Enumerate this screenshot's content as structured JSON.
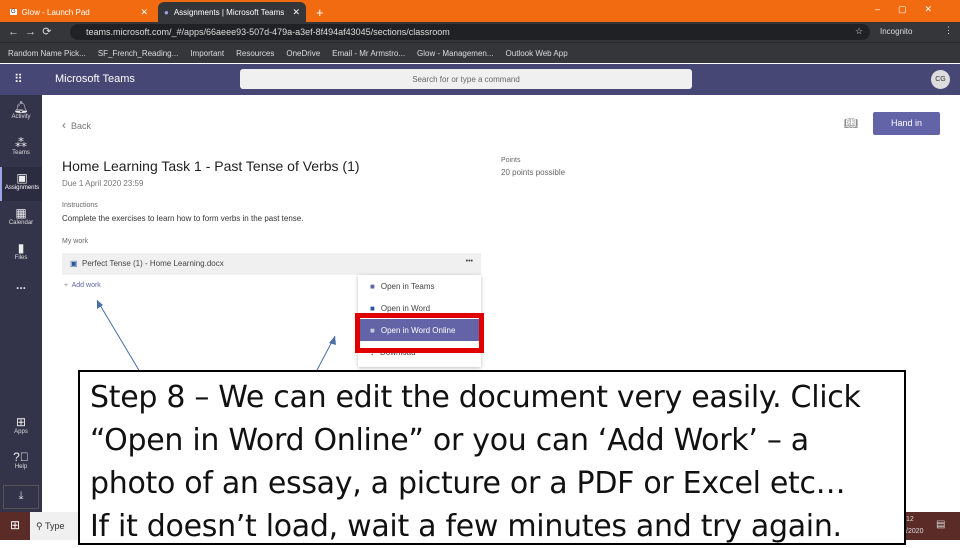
{
  "browser": {
    "tabs": [
      {
        "label": "Glow - Launch Pad"
      },
      {
        "label": "Assignments | Microsoft Teams"
      }
    ],
    "new_tab": "+",
    "url": "teams.microsoft.com/_#/apps/66aeee93-507d-479a-a3ef-8f494af43045/sections/classroom",
    "profile": "Incognito",
    "bookmarks": [
      "Random Name Pick...",
      "SF_French_Reading...",
      "Important",
      "Resources",
      "OneDrive",
      "Email - Mr Armstro...",
      "Glow - Managemen...",
      "Outlook Web App"
    ]
  },
  "teams": {
    "app_name": "Microsoft Teams",
    "search_placeholder": "Search for or type a command",
    "avatar": "CG"
  },
  "sidebar": {
    "items": [
      {
        "label": "Activity"
      },
      {
        "label": "Teams"
      },
      {
        "label": "Assignments"
      },
      {
        "label": "Calendar"
      },
      {
        "label": "Files"
      },
      {
        "label": "..."
      },
      {
        "label": "Apps"
      },
      {
        "label": "Help"
      }
    ]
  },
  "assignment": {
    "back": "Back",
    "hand_in": "Hand in",
    "title": "Home Learning Task 1 - Past Tense of Verbs (1)",
    "due": "Due 1 April 2020 23:59",
    "points_label": "Points",
    "points_value": "20 points possible",
    "instructions_label": "Instructions",
    "instructions": "Complete the exercises to learn how to form verbs in the past tense.",
    "my_work_label": "My work",
    "file": "Perfect Tense (1) - Home Learning.docx",
    "more": "•••",
    "add_work": "Add work"
  },
  "menu": {
    "items": [
      "Open in Teams",
      "Open in Word",
      "Open in Word Online",
      "Download"
    ]
  },
  "taskbar": {
    "search": "Type",
    "time": "12",
    "date": "/2020"
  },
  "caption": {
    "lines": [
      "Step 8 – We can edit the document very easily. Click",
      "“Open in Word Online” or you can ‘Add Work’ – a",
      "photo of an essay, a picture or a PDF or Excel etc…",
      "If it doesn’t load, wait a few minutes and try again."
    ]
  },
  "colors": {
    "chrome_orange": "#f26b10",
    "teams_purple": "#464775",
    "button": "#6264a7",
    "highlight": "#e00000"
  }
}
